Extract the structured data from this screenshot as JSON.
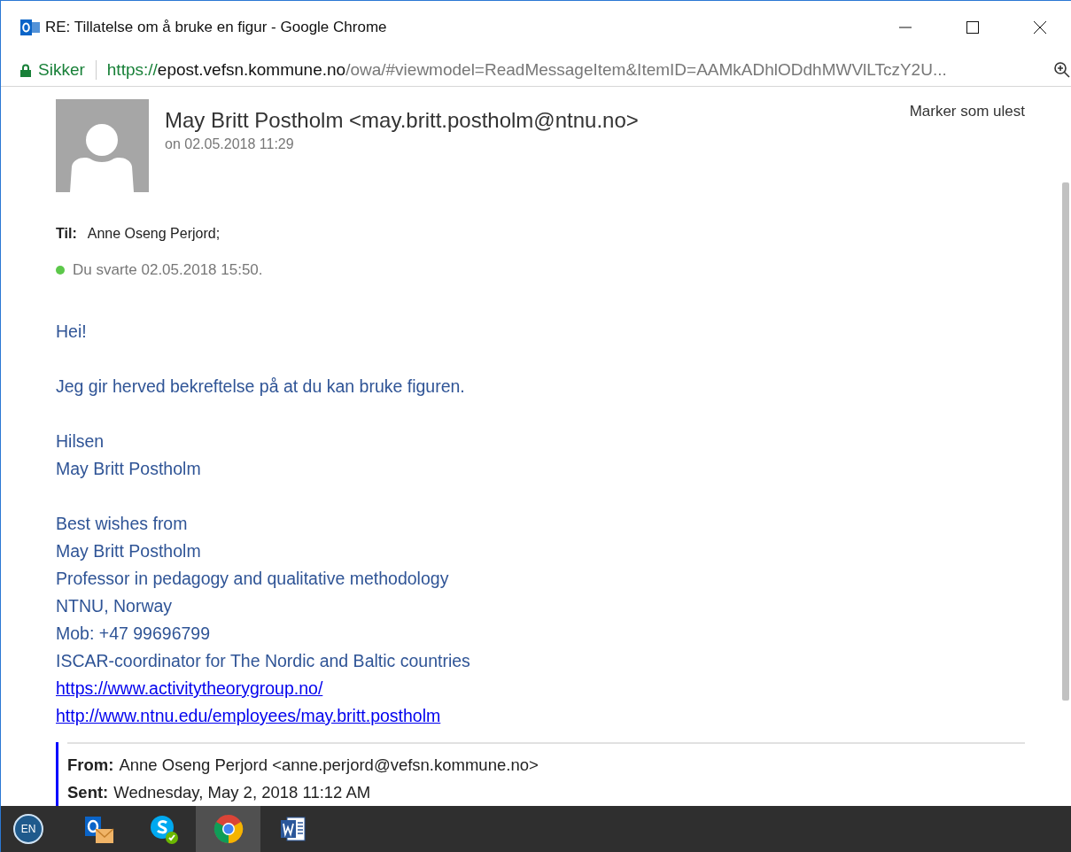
{
  "window": {
    "title": "RE: Tillatelse om å bruke en figur - Google Chrome"
  },
  "address_bar": {
    "security": "Sikker",
    "url_scheme": "https://",
    "url_host": "epost.vefsn.kommune.no",
    "url_path": "/owa/#viewmodel=ReadMessageItem&ItemID=AAMkADhlODdhMWVlLTczY2U..."
  },
  "message": {
    "sender": "May Britt Postholm <may.britt.postholm@ntnu.no>",
    "date": "on 02.05.2018 11:29",
    "mark_unread": "Marker som ulest",
    "to_label": "Til:",
    "to": "Anne Oseng Perjord;",
    "reply_status": "Du svarte 02.05.2018 15:50.",
    "body": [
      {
        "kind": "text",
        "text": "Hei!"
      },
      {
        "kind": "gap"
      },
      {
        "kind": "text",
        "text": "Jeg gir herved bekreftelse på at du kan bruke figuren."
      },
      {
        "kind": "gap"
      },
      {
        "kind": "text",
        "text": "Hilsen"
      },
      {
        "kind": "text",
        "text": "May Britt Postholm"
      },
      {
        "kind": "gap"
      },
      {
        "kind": "text",
        "text": "Best wishes from"
      },
      {
        "kind": "text",
        "text": "May Britt Postholm"
      },
      {
        "kind": "text",
        "text": "Professor in pedagogy and qualitative methodology"
      },
      {
        "kind": "text",
        "text": "NTNU, Norway"
      },
      {
        "kind": "text",
        "text": "Mob: +47 99696799"
      },
      {
        "kind": "text",
        "text": "ISCAR-coordinator for The Nordic and Baltic countries"
      },
      {
        "kind": "link",
        "text": "https://www.activitytheorygroup.no/"
      },
      {
        "kind": "link",
        "text": "http://www.ntnu.edu/employees/may.britt.postholm"
      }
    ],
    "quoted": [
      {
        "label": "From:",
        "value": "Anne Oseng Perjord <anne.perjord@vefsn.kommune.no>"
      },
      {
        "label": "Sent:",
        "value": "Wednesday, May 2, 2018 11:12 AM"
      }
    ]
  },
  "taskbar": {
    "language": "EN",
    "apps": [
      {
        "kind": "outlook",
        "selected": false
      },
      {
        "kind": "skype",
        "selected": false
      },
      {
        "kind": "chrome",
        "selected": true
      },
      {
        "kind": "word",
        "selected": false
      }
    ]
  }
}
